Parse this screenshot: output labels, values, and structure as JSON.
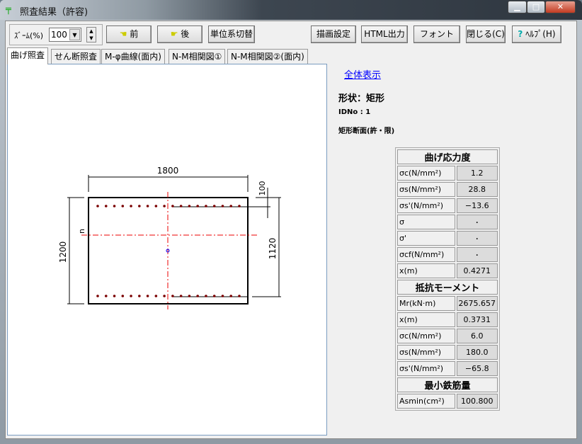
{
  "window": {
    "title": "照査結果（許容)",
    "icon": "app-icon",
    "controls": [
      "minimize",
      "maximize",
      "close"
    ]
  },
  "toolbar": {
    "zoom_label": "ｽﾞｰﾑ(%)",
    "zoom_value": "100",
    "prev": "前",
    "next": "後",
    "unit_switch": "単位系切替",
    "draw_settings": "描画設定",
    "html_output": "HTML出力",
    "font": "フォント",
    "close": "閉じる(C)",
    "help": "ﾍﾙﾌﾟ(H)"
  },
  "tabs": [
    "曲げ照査",
    "せん断照査",
    "M-φ曲線(面内)",
    "N-M相関図①",
    "N-M相関図②(面内)"
  ],
  "drawing": {
    "width_dim": "1800",
    "height_dim": "1200",
    "effective_depth": "1120",
    "cover": "100",
    "neutral_axis": "n",
    "bars_per_row": 18
  },
  "info": {
    "show_all": "全体表示",
    "shape": "形状：矩形",
    "id": "IDNo : 1",
    "section": "矩形断面(許・限)"
  },
  "table": {
    "bending_header": "曲げ応力度",
    "bending": [
      [
        "σc(N/mm²)",
        "1.2"
      ],
      [
        "σs(N/mm²)",
        "28.8"
      ],
      [
        "σs'(N/mm²)",
        "−13.6"
      ],
      [
        "σ",
        "･"
      ],
      [
        "σ'",
        "･"
      ],
      [
        "σcf(N/mm²)",
        "･"
      ],
      [
        "x(m)",
        "0.4271"
      ]
    ],
    "moment_header": "抵抗モーメント",
    "moment": [
      [
        "Mr(kN·m)",
        "2675.657"
      ],
      [
        "x(m)",
        "0.3731"
      ],
      [
        "σc(N/mm²)",
        "6.0"
      ],
      [
        "σs(N/mm²)",
        "180.0"
      ],
      [
        "σs'(N/mm²)",
        "−65.8"
      ]
    ],
    "min_header": "最小鉄筋量",
    "min": [
      [
        "Asmin(cm²)",
        "100.800"
      ]
    ]
  }
}
